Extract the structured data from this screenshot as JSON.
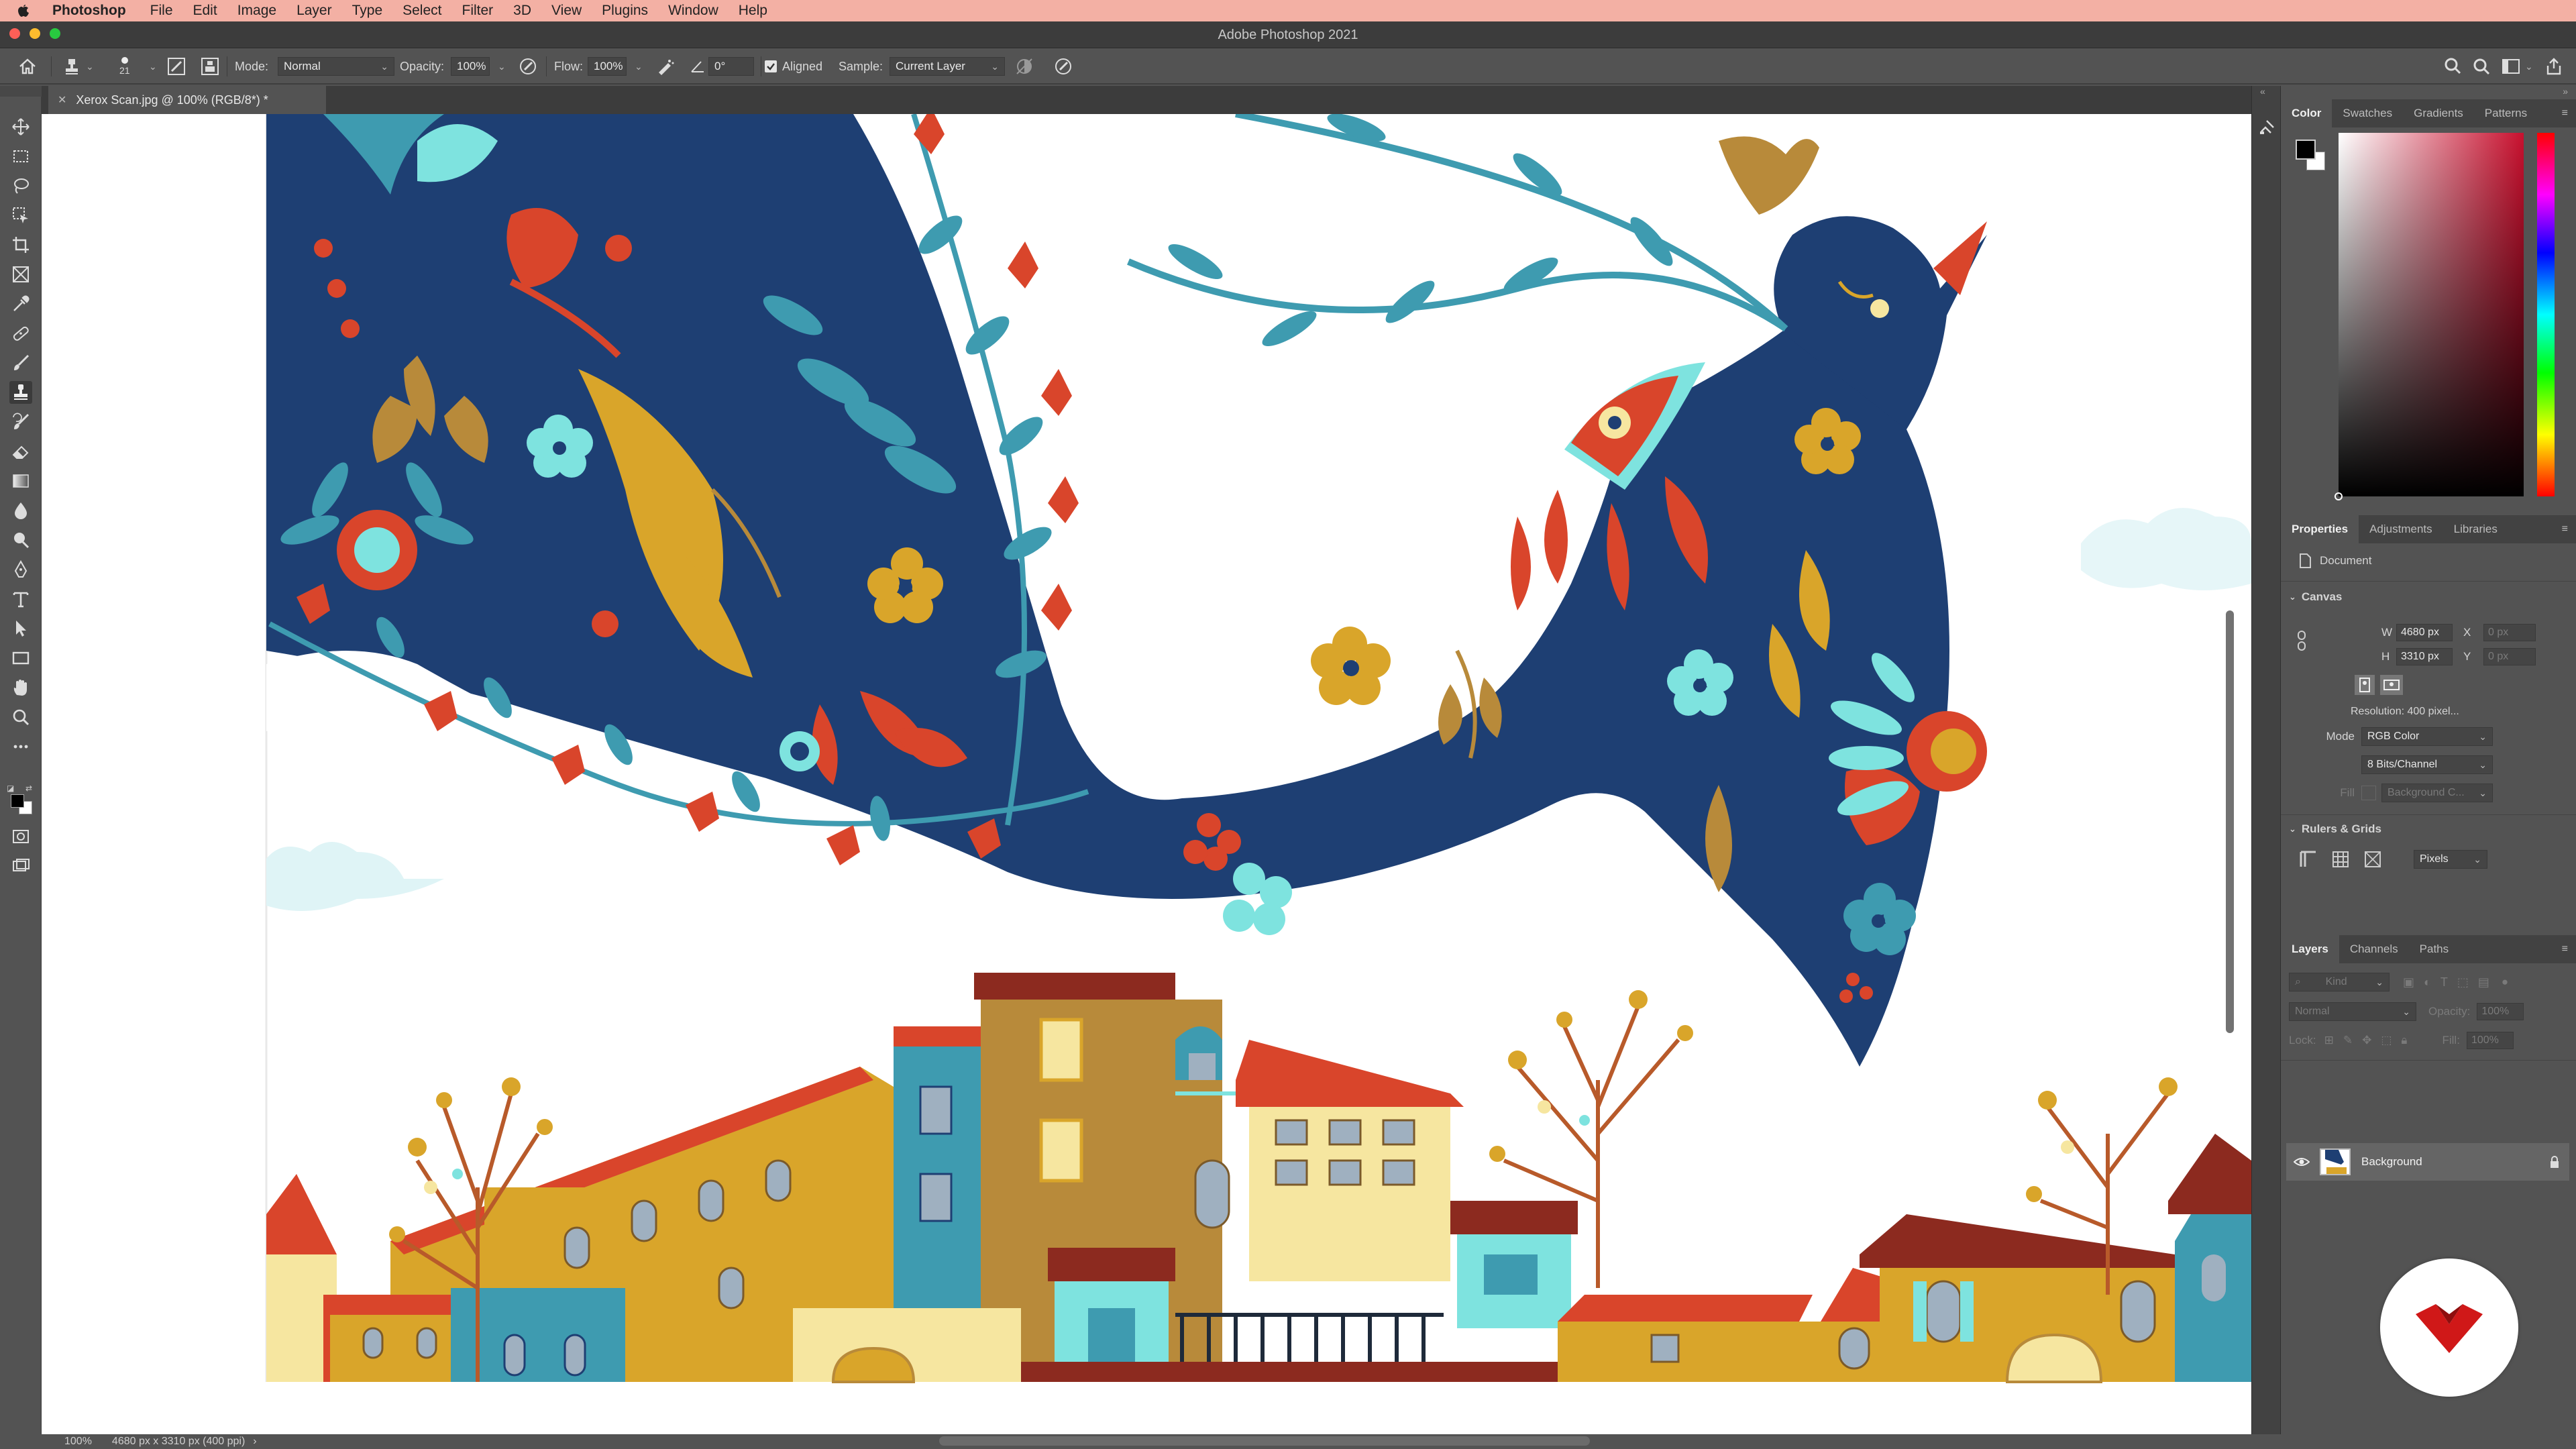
{
  "menubar": {
    "app": "Photoshop",
    "items": [
      "File",
      "Edit",
      "Image",
      "Layer",
      "Type",
      "Select",
      "Filter",
      "3D",
      "View",
      "Plugins",
      "Window",
      "Help"
    ]
  },
  "window": {
    "title": "Adobe Photoshop 2021"
  },
  "options": {
    "brush_size": "21",
    "mode_label": "Mode:",
    "mode_value": "Normal",
    "opacity_label": "Opacity:",
    "opacity_value": "100%",
    "flow_label": "Flow:",
    "flow_value": "100%",
    "angle_value": "0°",
    "aligned_label": "Aligned",
    "aligned_checked": true,
    "sample_label": "Sample:",
    "sample_value": "Current Layer"
  },
  "document": {
    "tab_title": "Xerox Scan.jpg @ 100% (RGB/8*) *",
    "zoom": "100%",
    "status": "4680 px x 3310 px (400 ppi)"
  },
  "tools": [
    "move-tool",
    "marquee-tool",
    "lasso-tool",
    "object-selection-tool",
    "crop-tool",
    "frame-tool",
    "eyedropper-tool",
    "healing-brush-tool",
    "brush-tool",
    "clone-stamp-tool",
    "history-brush-tool",
    "eraser-tool",
    "gradient-tool",
    "blur-tool",
    "dodge-tool",
    "pen-tool",
    "type-tool",
    "path-selection-tool",
    "rectangle-tool",
    "hand-tool",
    "zoom-tool",
    "more-tools"
  ],
  "color_panel": {
    "tabs": [
      "Color",
      "Swatches",
      "Gradients",
      "Patterns"
    ],
    "active_tab": "Color",
    "foreground": "#000000",
    "background": "#ffffff",
    "hue": "#c8102e"
  },
  "properties_panel": {
    "tabs": [
      "Properties",
      "Adjustments",
      "Libraries"
    ],
    "active_tab": "Properties",
    "section_document": "Document",
    "canvas_header": "Canvas",
    "w_label": "W",
    "w_value": "4680 px",
    "h_label": "H",
    "h_value": "3310 px",
    "x_label": "X",
    "x_placeholder": "0 px",
    "y_label": "Y",
    "y_placeholder": "0 px",
    "resolution": "Resolution: 400 pixel...",
    "mode_label": "Mode",
    "mode_value": "RGB Color",
    "depth_value": "8 Bits/Channel",
    "fill_label": "Fill",
    "fill_value": "Background C...",
    "rulers_header": "Rulers & Grids",
    "units_value": "Pixels"
  },
  "layers_panel": {
    "tabs": [
      "Layers",
      "Channels",
      "Paths"
    ],
    "active_tab": "Layers",
    "kind_placeholder": "Kind",
    "blend_mode": "Normal",
    "opacity_label": "Opacity:",
    "opacity_value": "100%",
    "lock_label": "Lock:",
    "fill_label": "Fill:",
    "fill_value": "100%",
    "layers": [
      {
        "name": "Background",
        "visible": true,
        "locked": true
      }
    ]
  },
  "colors": {
    "menubar": "#f3b0a4",
    "navy": "#1e3f73",
    "teal": "#3e9bb0",
    "red": "#d9452b",
    "mustard": "#d9a52a",
    "ochre": "#b88a3a",
    "cream": "#f6e6a0",
    "mint": "#7ee3df",
    "brand_red": "#d01818"
  }
}
